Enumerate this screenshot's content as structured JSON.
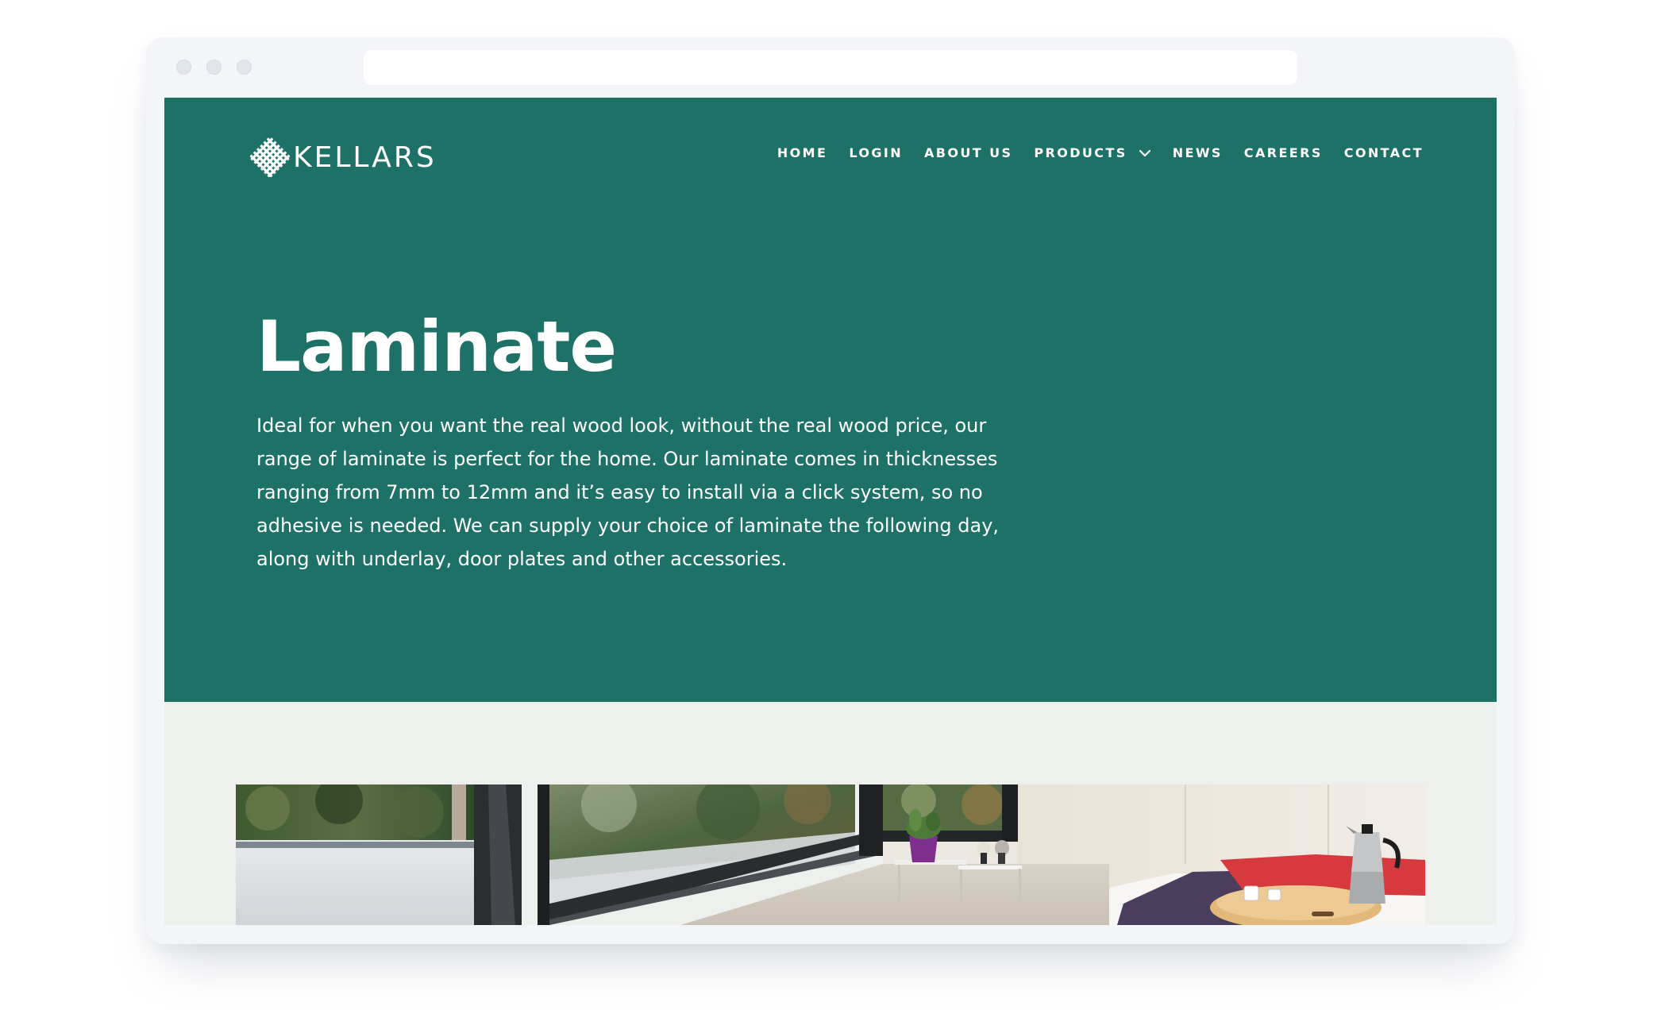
{
  "brand": {
    "name": "KELLARS"
  },
  "nav": {
    "items": [
      {
        "label": "HOME"
      },
      {
        "label": "LOGIN"
      },
      {
        "label": "ABOUT US"
      },
      {
        "label": "PRODUCTS"
      },
      {
        "label": "NEWS"
      },
      {
        "label": "CAREERS"
      },
      {
        "label": "CONTACT"
      }
    ]
  },
  "hero": {
    "title": "Laminate",
    "description": "Ideal for when you want the real wood look, without the real wood price, our range of laminate is perfect for the home. Our laminate comes in thicknesses ranging from 7mm to 12mm and it’s easy to install via a click system, so no adhesive is needed. We can supply your choice of laminate the following day, along with underlay, door plates and other accessories."
  },
  "colors": {
    "hero_bg": "#1e7166",
    "page_bg": "#eef0ee",
    "browser_frame": "#f3f5f8"
  },
  "icons": {
    "logo": "kellars-weave-logo-icon",
    "products_dropdown": "chevron-down-icon"
  }
}
